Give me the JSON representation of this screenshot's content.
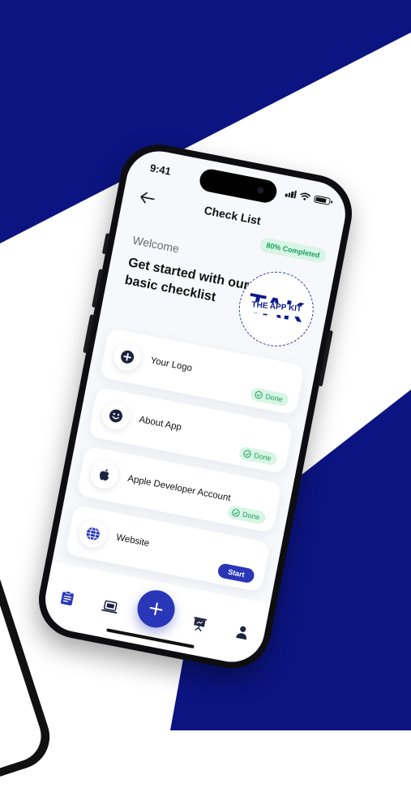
{
  "colors": {
    "navy": "#0b1480",
    "accent": "#2a36b8",
    "done_bg": "#d8f5e6",
    "done_text": "#1aa15b"
  },
  "status_bar": {
    "time": "9:41"
  },
  "header": {
    "title": "Check List",
    "progress": "80% Completed"
  },
  "welcome": "Welcome",
  "headline": "Get started with our basic checklist",
  "logo": {
    "big_text": "TAK",
    "small_text": "THE APP KIT"
  },
  "checklist": [
    {
      "label": "Your Logo",
      "status": "Done",
      "icon": "add-icon"
    },
    {
      "label": "About App",
      "status": "Done",
      "icon": "smiley-icon"
    },
    {
      "label": "Apple Developer Account",
      "status": "Done",
      "icon": "apple-icon"
    },
    {
      "label": "Website",
      "status": "Start",
      "icon": "globe-icon"
    }
  ],
  "tabbar": {
    "items": [
      "checklist-icon",
      "laptop-icon",
      "add-icon",
      "presentation-icon",
      "profile-icon"
    ]
  }
}
